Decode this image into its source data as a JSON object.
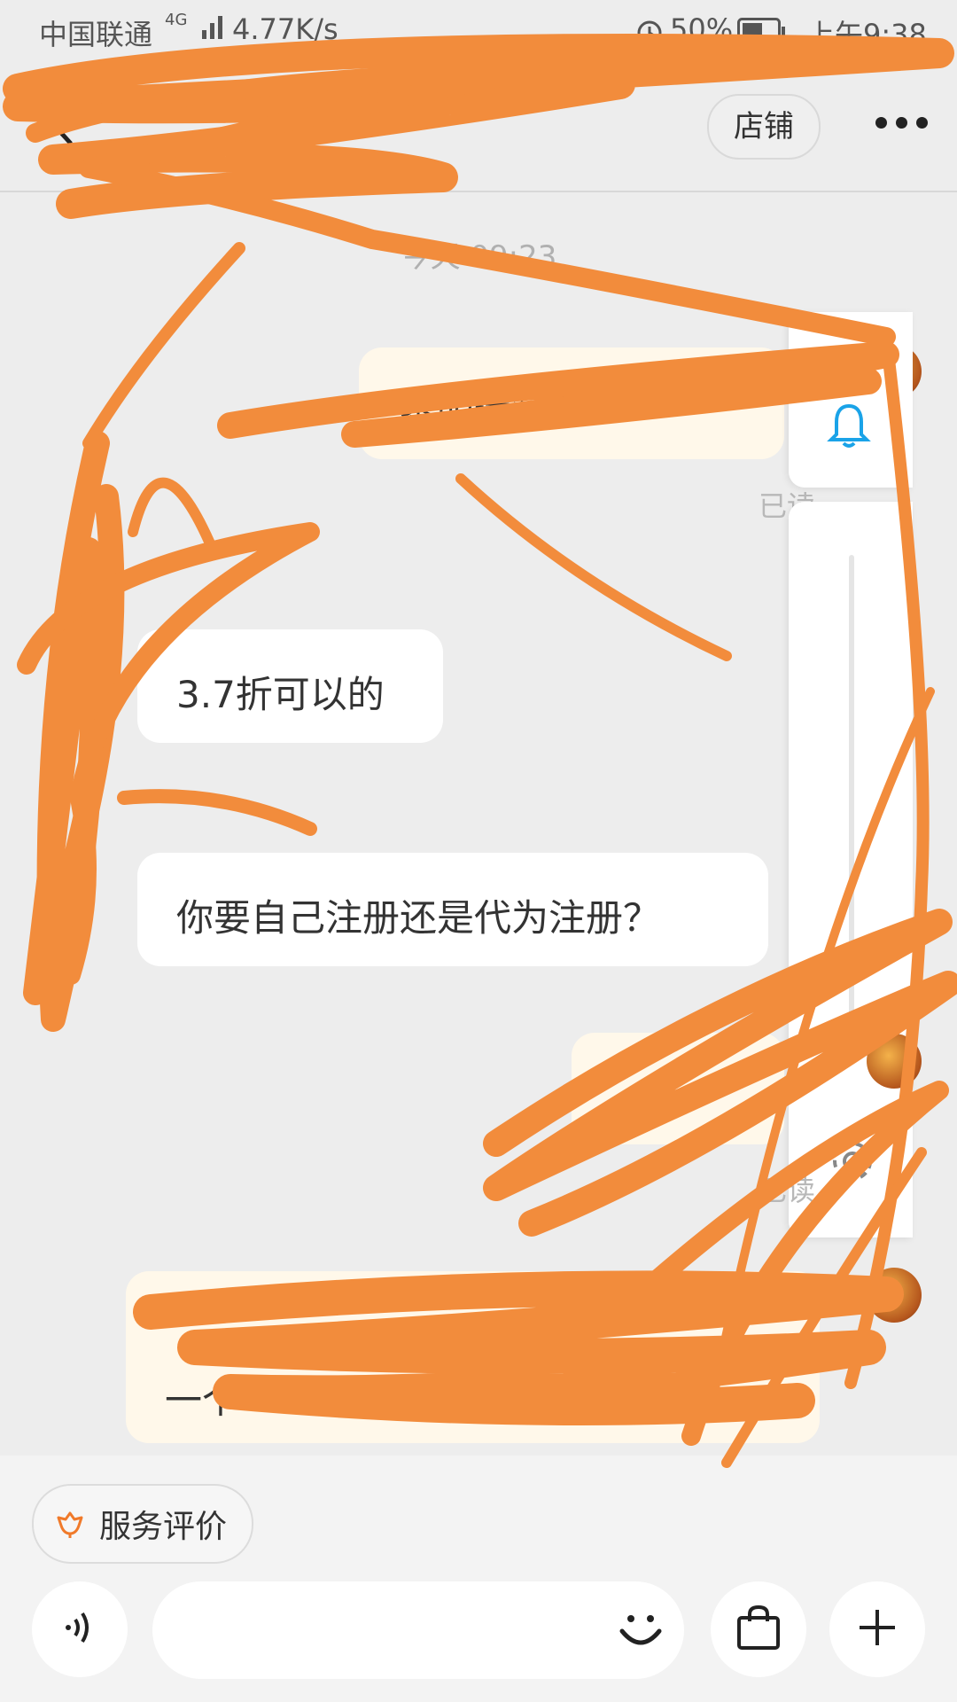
{
  "status_bar": {
    "carrier": "中国联通",
    "network": "4G",
    "speed": "4.77K/s",
    "battery": "50%",
    "time": "上午9:38"
  },
  "header": {
    "shop_label": "店铺"
  },
  "chat": {
    "timestamp": "今天 09:23",
    "messages": [
      {
        "side": "sent",
        "text": "黎明远征多",
        "status": "已读"
      },
      {
        "side": "received",
        "text": "3.7折可以的"
      },
      {
        "side": "received",
        "text": "你要自己注册还是代为注册？"
      },
      {
        "side": "sent",
        "text": "",
        "status": "已读"
      },
      {
        "side": "sent",
        "text": "一个"
      }
    ]
  },
  "bottom": {
    "rate_label": "服务评价",
    "input_placeholder": ""
  },
  "colors": {
    "accent": "#f0a020",
    "scribble": "#f28c3c",
    "sent_bubble": "#fff8ea",
    "side_icon": "#1aa3e8"
  }
}
